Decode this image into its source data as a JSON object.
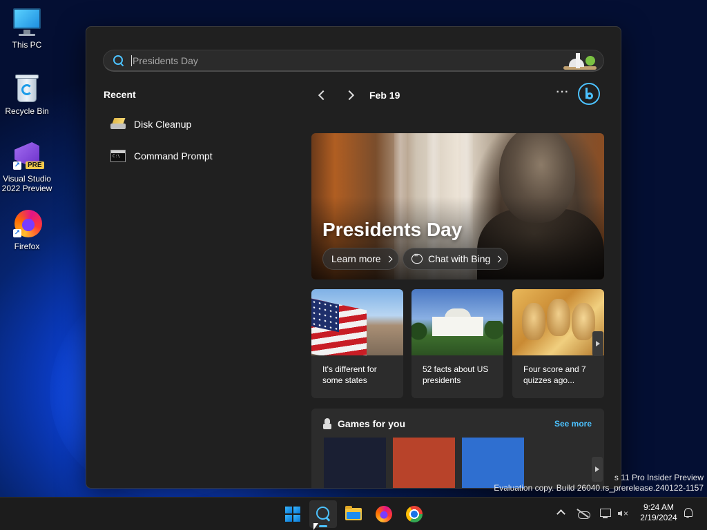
{
  "desktop": {
    "icons": [
      {
        "label": "This PC"
      },
      {
        "label": "Recycle Bin"
      },
      {
        "label": "Visual Studio 2022 Preview",
        "badge": "PRE"
      },
      {
        "label": "Firefox"
      }
    ]
  },
  "search": {
    "placeholder": "Presidents Day",
    "value": ""
  },
  "recent": {
    "title": "Recent",
    "items": [
      {
        "label": "Disk Cleanup",
        "icon": "disk-cleanup-icon"
      },
      {
        "label": "Command Prompt",
        "icon": "command-prompt-icon"
      }
    ]
  },
  "highlights": {
    "date": "Feb 19",
    "more_glyph": "···",
    "hero": {
      "title": "Presidents Day",
      "learn_more": "Learn more",
      "chat_with_bing": "Chat with Bing"
    },
    "cards": [
      {
        "caption": "It's different for some states"
      },
      {
        "caption": "52 facts about US presidents"
      },
      {
        "caption": "Four score and 7 quizzes ago..."
      }
    ],
    "games": {
      "title": "Games for you",
      "see_more": "See more",
      "tile_colors": [
        "#1a1f33",
        "#b8432a",
        "#2f6fd0"
      ]
    }
  },
  "watermark": {
    "line1": "s 11 Pro Insider Preview",
    "line2": "Evaluation copy. Build 26040.rs_prerelease.240122-1157"
  },
  "taskbar": {
    "time": "9:24 AM",
    "date": "2/19/2024"
  },
  "colors": {
    "accent": "#4cc2ff",
    "panel": "#202020",
    "card": "#2c2c2c"
  }
}
